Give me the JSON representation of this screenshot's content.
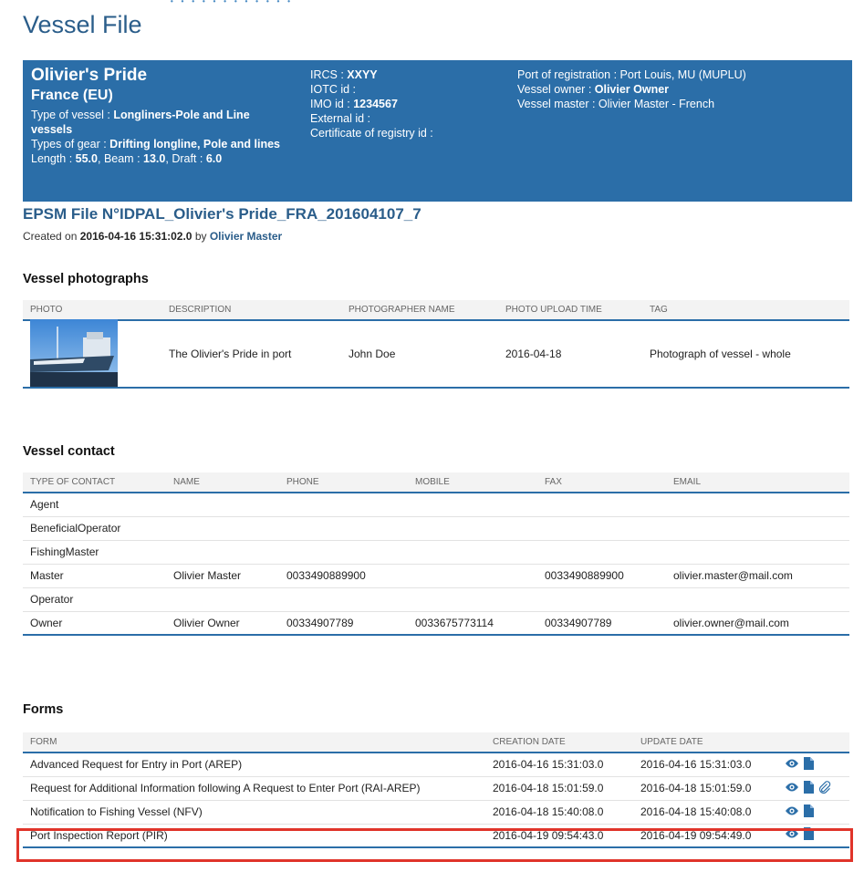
{
  "header": {
    "cut_text": "...",
    "page_title": "Vessel File"
  },
  "vessel": {
    "name": "Olivier's Pride",
    "flag": "France (EU)",
    "type_label": "Type of vessel : ",
    "type_value": "Longliners-Pole and Line vessels",
    "gear_label": "Types of gear : ",
    "gear_value": "Drifting longline, Pole and lines",
    "length_label": "Length : ",
    "length_value": "55.0",
    "beam_label": ", Beam : ",
    "beam_value": "13.0",
    "draft_label": ", Draft : ",
    "draft_value": "6.0",
    "ircs_label": "IRCS : ",
    "ircs_value": "XXYY",
    "iotc_label": "IOTC id :",
    "imo_label": "IMO id : ",
    "imo_value": "1234567",
    "external_label": "External id :",
    "cert_label": "Certificate of registry id :",
    "port_text": "Port of registration : Port Louis, MU (MUPLU)",
    "owner_label": "Vessel owner : ",
    "owner_value": "Olivier Owner",
    "master_text": "Vessel master : Olivier Master - French"
  },
  "epsm": {
    "title": "EPSM File N°IDPAL_Olivier's Pride_FRA_201604107_7",
    "created_prefix": "Created on ",
    "created_date": "2016-04-16 15:31:02.0",
    "created_by": " by ",
    "created_name": "Olivier Master"
  },
  "photos": {
    "title": "Vessel photographs",
    "headers": [
      "PHOTO",
      "DESCRIPTION",
      "PHOTOGRAPHER NAME",
      "PHOTO UPLOAD TIME",
      "TAG"
    ],
    "rows": [
      {
        "description": "The Olivier's Pride in port",
        "photographer": "John Doe",
        "upload_time": "2016-04-18",
        "tag": "Photograph of vessel - whole"
      }
    ]
  },
  "contacts": {
    "title": "Vessel contact",
    "headers": [
      "TYPE OF CONTACT",
      "NAME",
      "PHONE",
      "MOBILE",
      "FAX",
      "EMAIL"
    ],
    "rows": [
      {
        "type": "Agent",
        "name": "",
        "phone": "",
        "mobile": "",
        "fax": "",
        "email": ""
      },
      {
        "type": "BeneficialOperator",
        "name": "",
        "phone": "",
        "mobile": "",
        "fax": "",
        "email": ""
      },
      {
        "type": "FishingMaster",
        "name": "",
        "phone": "",
        "mobile": "",
        "fax": "",
        "email": ""
      },
      {
        "type": "Master",
        "name": "Olivier Master",
        "phone": "0033490889900",
        "mobile": "",
        "fax": "0033490889900",
        "email": "olivier.master@mail.com"
      },
      {
        "type": "Operator",
        "name": "",
        "phone": "",
        "mobile": "",
        "fax": "",
        "email": ""
      },
      {
        "type": "Owner",
        "name": "Olivier Owner",
        "phone": "00334907789",
        "mobile": "0033675773114",
        "fax": "00334907789",
        "email": "olivier.owner@mail.com"
      }
    ]
  },
  "forms": {
    "title": "Forms",
    "headers": [
      "FORM",
      "CREATION DATE",
      "UPDATE DATE",
      ""
    ],
    "rows": [
      {
        "form": "Advanced Request for Entry in Port (AREP)",
        "created": "2016-04-16 15:31:03.0",
        "updated": "2016-04-16 15:31:03.0",
        "icons": [
          "eye-icon",
          "document-icon"
        ]
      },
      {
        "form": "Request for Additional Information following A Request to Enter Port (RAI-AREP)",
        "created": "2016-04-18 15:01:59.0",
        "updated": "2016-04-18 15:01:59.0",
        "icons": [
          "eye-icon",
          "document-icon",
          "paperclip-icon"
        ]
      },
      {
        "form": "Notification to Fishing Vessel (NFV)",
        "created": "2016-04-18 15:40:08.0",
        "updated": "2016-04-18 15:40:08.0",
        "icons": [
          "eye-icon",
          "document-icon"
        ]
      },
      {
        "form": "Port Inspection Report (PIR)",
        "created": "2016-04-19 09:54:43.0",
        "updated": "2016-04-19 09:54:49.0",
        "icons": [
          "eye-icon",
          "document-icon"
        ]
      }
    ]
  },
  "colors": {
    "primary": "#2b6ea8",
    "title": "#2a5d8a",
    "highlight": "#e0342a"
  }
}
